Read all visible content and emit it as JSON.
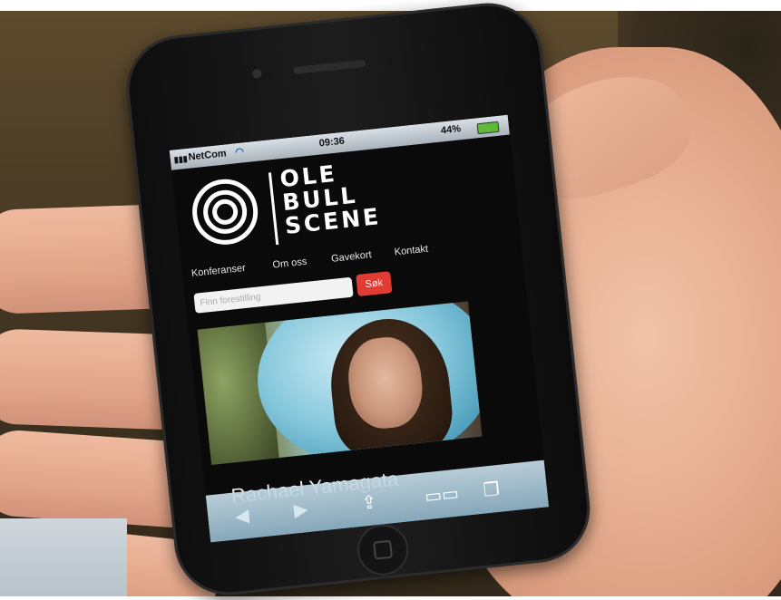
{
  "status_bar": {
    "carrier": "NetCom",
    "time": "09:36",
    "battery_percent": "44%"
  },
  "logo": {
    "lines": [
      "OLE",
      "BULL",
      "SCENE"
    ]
  },
  "nav": {
    "items": [
      "Konferanser",
      "Om oss",
      "Gavekort",
      "Kontakt"
    ]
  },
  "search": {
    "placeholder": "Finn forestilling",
    "button_label": "Søk"
  },
  "feature": {
    "title": "Rachael Yamagata"
  },
  "icons": {
    "back": "back-arrow-icon",
    "forward": "forward-arrow-icon",
    "share": "share-icon",
    "bookmarks": "bookmarks-icon",
    "tabs": "tabs-icon",
    "wifi": "wifi-icon",
    "signal": "signal-icon",
    "battery": "battery-icon"
  },
  "colors": {
    "search_button": "#e23b34",
    "toolbar": "#a8c6d6"
  }
}
